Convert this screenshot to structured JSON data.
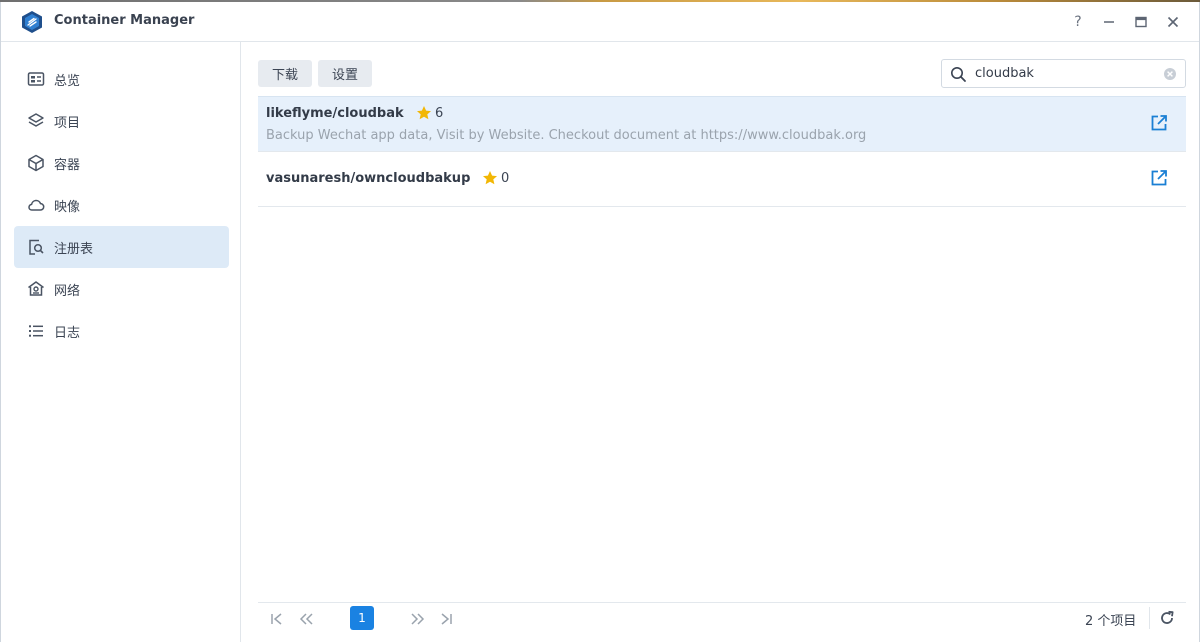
{
  "window": {
    "title": "Container Manager",
    "icons": {
      "app": "container-manager-logo",
      "help": "help-icon",
      "minimize": "minimize-icon",
      "maximize": "maximize-icon",
      "close": "close-icon"
    },
    "help_label": "?"
  },
  "sidebar": {
    "items": [
      {
        "label": "总览",
        "icon": "overview-icon",
        "active": false
      },
      {
        "label": "项目",
        "icon": "layers-icon",
        "active": false
      },
      {
        "label": "容器",
        "icon": "cube-icon",
        "active": false
      },
      {
        "label": "映像",
        "icon": "cloud-icon",
        "active": false
      },
      {
        "label": "注册表",
        "icon": "registry-search-icon",
        "active": true
      },
      {
        "label": "网络",
        "icon": "network-home-icon",
        "active": false
      },
      {
        "label": "日志",
        "icon": "list-icon",
        "active": false
      }
    ]
  },
  "toolbar": {
    "download_label": "下载",
    "settings_label": "设置"
  },
  "search": {
    "value": "cloudbak",
    "placeholder": ""
  },
  "results": [
    {
      "name": "likeflyme/cloudbak",
      "stars": "6",
      "description": "Backup Wechat app data, Visit by Website. Checkout document at https://www.cloudbak.org",
      "selected": true
    },
    {
      "name": "vasunaresh/owncloudbakup",
      "stars": "0",
      "description": "",
      "selected": false
    }
  ],
  "pager": {
    "current_page": "1",
    "item_count": "2 个项目"
  },
  "colors": {
    "accent": "#1a82e2",
    "selected_row": "#e6f0fb",
    "active_nav": "#ddeaf7",
    "star": "#f2b705",
    "muted_text": "#9aa3ad"
  }
}
